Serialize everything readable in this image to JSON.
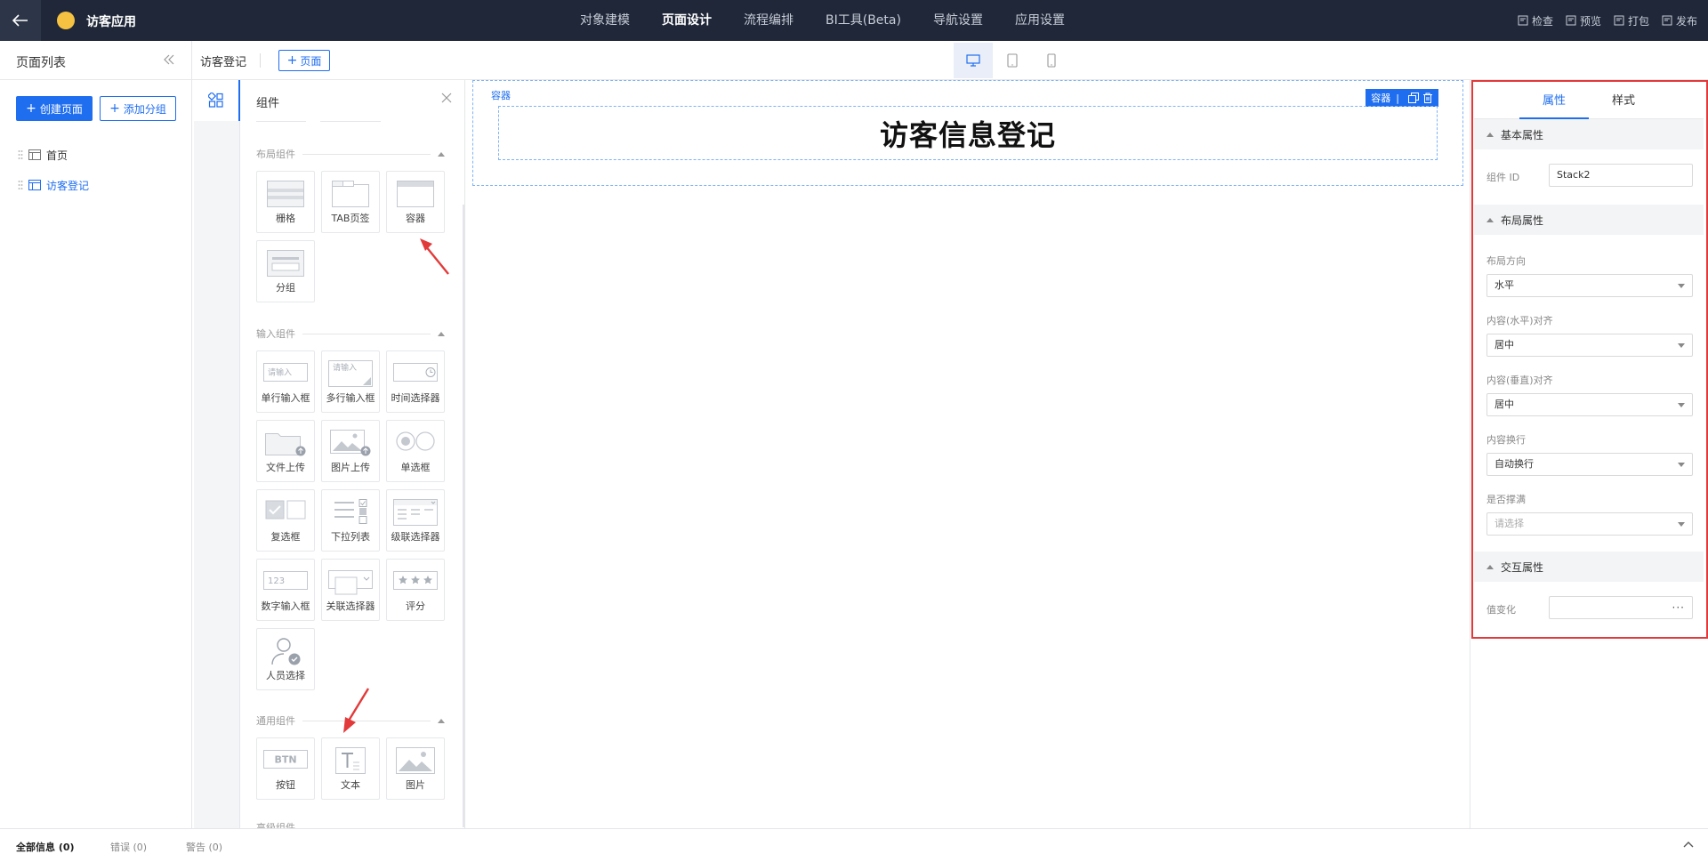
{
  "topbar": {
    "app_name": "访客应用",
    "nav": [
      "对象建模",
      "页面设计",
      "流程编排",
      "BI工具(Beta)",
      "导航设置",
      "应用设置"
    ],
    "active_nav": "页面设计",
    "actions": [
      {
        "label": "检查",
        "icon": "check-doc-icon"
      },
      {
        "label": "预览",
        "icon": "preview-icon"
      },
      {
        "label": "打包",
        "icon": "package-icon"
      },
      {
        "label": "发布",
        "icon": "publish-icon"
      }
    ]
  },
  "pages": {
    "title": "页面列表",
    "create_label": "创建页面",
    "add_group_label": "添加分组",
    "items": [
      {
        "label": "首页",
        "active": false
      },
      {
        "label": "访客登记",
        "active": true
      }
    ]
  },
  "subheader": {
    "crumb": "访客登记",
    "add_page_label": "页面",
    "devices": [
      "desktop-icon",
      "tablet-icon",
      "mobile-icon"
    ]
  },
  "components": {
    "title": "组件",
    "sections": [
      {
        "title": "布局组件",
        "items": [
          {
            "label": "栅格",
            "icon": "grid-layout-icon"
          },
          {
            "label": "TAB页签",
            "icon": "tab-icon"
          },
          {
            "label": "容器",
            "icon": "container-icon"
          },
          {
            "label": "分组",
            "icon": "group-icon"
          }
        ]
      },
      {
        "title": "输入组件",
        "items": [
          {
            "label": "单行输入框",
            "icon": "single-input-icon",
            "hint": "请输入"
          },
          {
            "label": "多行输入框",
            "icon": "textarea-icon",
            "hint": "请输入"
          },
          {
            "label": "时间选择器",
            "icon": "time-picker-icon"
          },
          {
            "label": "文件上传",
            "icon": "file-upload-icon"
          },
          {
            "label": "图片上传",
            "icon": "image-upload-icon"
          },
          {
            "label": "单选框",
            "icon": "radio-icon"
          },
          {
            "label": "复选框",
            "icon": "checkbox-icon"
          },
          {
            "label": "下拉列表",
            "icon": "dropdown-list-icon"
          },
          {
            "label": "级联选择器",
            "icon": "cascader-icon"
          },
          {
            "label": "数字输入框",
            "icon": "number-input-icon",
            "hint": "123"
          },
          {
            "label": "关联选择器",
            "icon": "relation-select-icon"
          },
          {
            "label": "评分",
            "icon": "rating-icon"
          },
          {
            "label": "人员选择",
            "icon": "user-select-icon"
          }
        ]
      },
      {
        "title": "通用组件",
        "items": [
          {
            "label": "按钮",
            "icon": "button-icon",
            "hint": "BTN"
          },
          {
            "label": "文本",
            "icon": "text-icon"
          },
          {
            "label": "图片",
            "icon": "image-icon"
          }
        ]
      },
      {
        "title": "高级组件",
        "items": []
      }
    ]
  },
  "canvas": {
    "container_tag": "容器",
    "toolbar_label": "容器",
    "form_title": "访客信息登记"
  },
  "properties": {
    "tabs": [
      "属性",
      "样式"
    ],
    "active_tab": "属性",
    "groups": {
      "basic": "基本属性",
      "layout": "布局属性",
      "interaction": "交互属性"
    },
    "component_id_label": "组件 ID",
    "component_id_value": "Stack2",
    "fields": [
      {
        "label": "布局方向",
        "value": "水平",
        "placeholder": false
      },
      {
        "label": "内容(水平)对齐",
        "value": "居中",
        "placeholder": false
      },
      {
        "label": "内容(垂直)对齐",
        "value": "居中",
        "placeholder": false
      },
      {
        "label": "内容换行",
        "value": "自动换行",
        "placeholder": false
      },
      {
        "label": "是否撑满",
        "value": "请选择",
        "placeholder": true
      }
    ],
    "value_change_label": "值变化",
    "value_change_button": "···"
  },
  "statusbar": {
    "tabs": [
      "全部信息 (0)",
      "错误 (0)",
      "警告 (0)"
    ]
  },
  "colors": {
    "topbar": "#1f2738",
    "accent": "#1f6ef0",
    "highlight": "#e23a3a"
  }
}
